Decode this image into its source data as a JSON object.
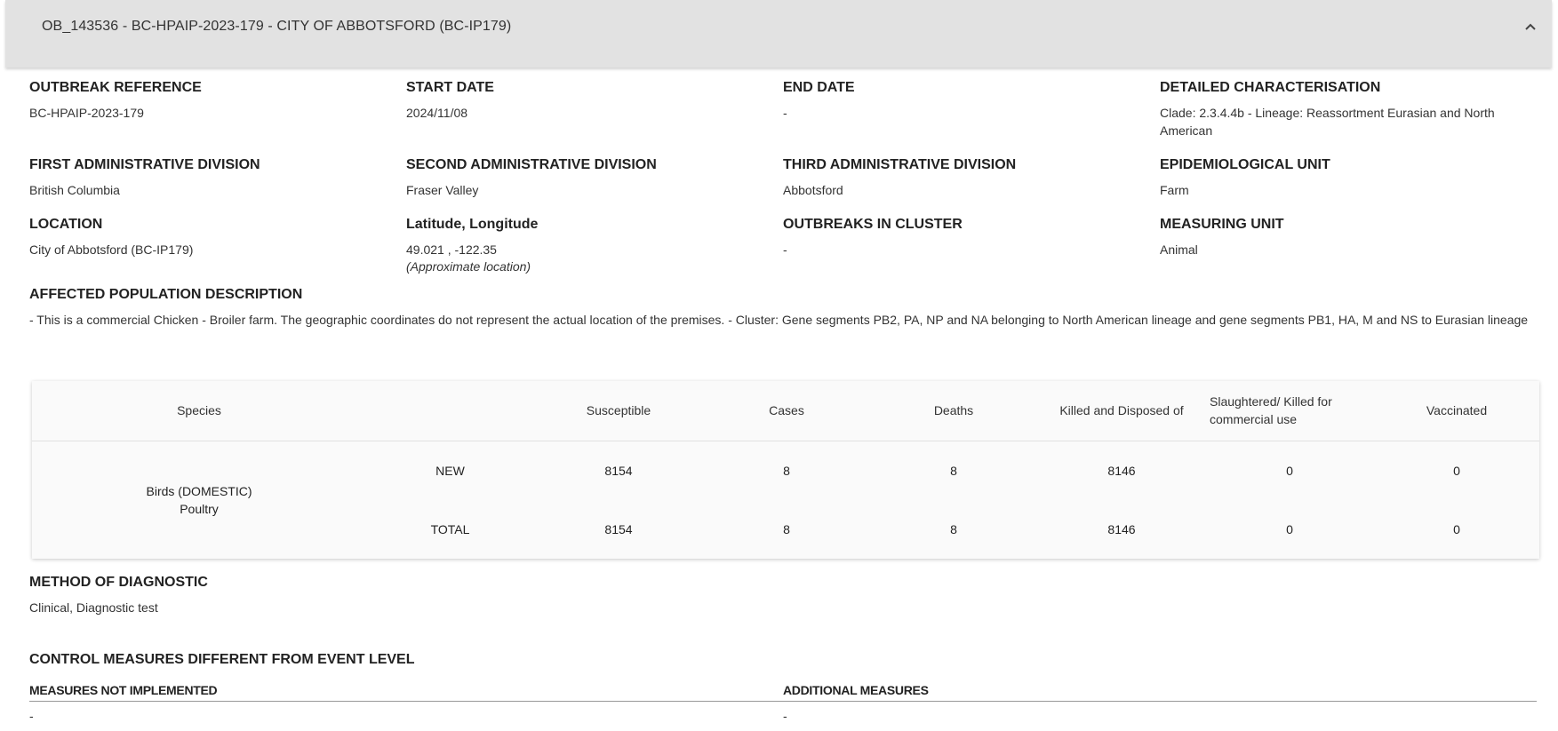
{
  "header": {
    "title": "OB_143536 - BC-HPAIP-2023-179 - CITY OF ABBOTSFORD (BC-IP179)"
  },
  "fields": {
    "outbreak_reference": {
      "label": "OUTBREAK REFERENCE",
      "value": "BC-HPAIP-2023-179"
    },
    "start_date": {
      "label": "START DATE",
      "value": "2024/11/08"
    },
    "end_date": {
      "label": "END DATE",
      "value": "-"
    },
    "detailed_characterisation": {
      "label": "DETAILED CHARACTERISATION",
      "value": "Clade: 2.3.4.4b - Lineage: Reassortment Eurasian and North American"
    },
    "first_admin": {
      "label": "FIRST ADMINISTRATIVE DIVISION",
      "value": "British Columbia"
    },
    "second_admin": {
      "label": "SECOND ADMINISTRATIVE DIVISION",
      "value": "Fraser Valley"
    },
    "third_admin": {
      "label": "THIRD ADMINISTRATIVE DIVISION",
      "value": "Abbotsford"
    },
    "epi_unit": {
      "label": "EPIDEMIOLOGICAL UNIT",
      "value": "Farm"
    },
    "location": {
      "label": "LOCATION",
      "value": "City of Abbotsford (BC-IP179)"
    },
    "lat_long": {
      "label": "Latitude, Longitude",
      "value": "49.021 , -122.35",
      "note": "(Approximate location)"
    },
    "outbreaks_cluster": {
      "label": "OUTBREAKS IN CLUSTER",
      "value": "-"
    },
    "measuring_unit": {
      "label": "MEASURING UNIT",
      "value": "Animal"
    },
    "affected_population": {
      "label": "AFFECTED POPULATION DESCRIPTION",
      "value": "- This is a commercial Chicken - Broiler farm. The geographic coordinates do not represent the actual location of the premises. - Cluster: Gene segments PB2, PA, NP and NA belonging to North American lineage and gene segments PB1, HA, M and NS to Eurasian lineage"
    }
  },
  "table": {
    "headers": {
      "species": "Species",
      "susceptible": "Susceptible",
      "cases": "Cases",
      "deaths": "Deaths",
      "killed": "Killed and Disposed of",
      "slaughtered": "Slaughtered/ Killed for commercial use",
      "vaccinated": "Vaccinated"
    },
    "species_line1": "Birds (DOMESTIC)",
    "species_line2": "Poultry",
    "rows": [
      {
        "type": "NEW",
        "susceptible": "8154",
        "cases": "8",
        "deaths": "8",
        "killed": "8146",
        "slaughtered": "0",
        "vaccinated": "0"
      },
      {
        "type": "TOTAL",
        "susceptible": "8154",
        "cases": "8",
        "deaths": "8",
        "killed": "8146",
        "slaughtered": "0",
        "vaccinated": "0"
      }
    ]
  },
  "diagnostic": {
    "label": "METHOD OF DIAGNOSTIC",
    "value": "Clinical, Diagnostic test"
  },
  "control_measures": {
    "label": "CONTROL MEASURES DIFFERENT FROM EVENT LEVEL",
    "not_implemented_label": "MEASURES NOT IMPLEMENTED",
    "not_implemented_value": "-",
    "additional_label": "ADDITIONAL MEASURES",
    "additional_value": "-"
  },
  "icons": {
    "collapse": "chevron-up-icon"
  }
}
